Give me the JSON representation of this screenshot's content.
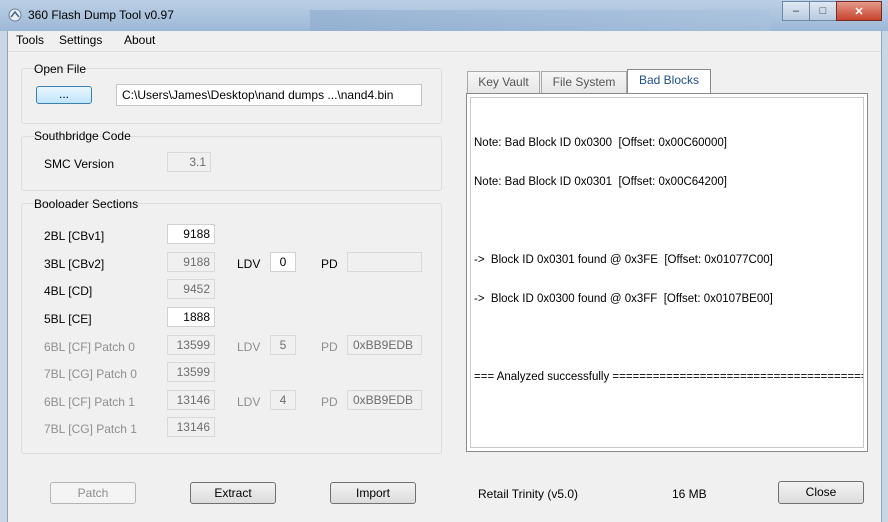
{
  "window": {
    "title": "360 Flash Dump Tool  v0.97",
    "buttons": {
      "minimize": "–",
      "maximize": "□",
      "close": "✕"
    }
  },
  "menu": {
    "items": [
      "Tools",
      "Settings",
      "About"
    ]
  },
  "open_file": {
    "title": "Open File",
    "button_label": "...",
    "path": "C:\\Users\\James\\Desktop\\nand dumps ...\\nand4.bin"
  },
  "southbridge": {
    "title": "Southbridge Code",
    "smc_label": "SMC Version",
    "smc_value": "3.1"
  },
  "bootloader": {
    "title": "Booloader Sections",
    "rows": [
      {
        "label": "2BL [CBv1]",
        "value": "9188"
      },
      {
        "label": "3BL [CBv2]",
        "value": "9188",
        "ldv_label": "LDV",
        "ldv": "0",
        "pd_label": "PD",
        "pd": ""
      },
      {
        "label": "4BL [CD]",
        "value": "9452"
      },
      {
        "label": "5BL [CE]",
        "value": "1888"
      },
      {
        "label": "6BL [CF] Patch 0",
        "value": "13599",
        "ldv_label": "LDV",
        "ldv": "5",
        "pd_label": "PD",
        "pd": "0xBB9EDB"
      },
      {
        "label": "7BL [CG] Patch 0",
        "value": "13599"
      },
      {
        "label": "6BL [CF] Patch 1",
        "value": "13146",
        "ldv_label": "LDV",
        "ldv": "4",
        "pd_label": "PD",
        "pd": "0xBB9EDB"
      },
      {
        "label": "7BL [CG] Patch 1",
        "value": "13146"
      }
    ]
  },
  "tabs": {
    "items": [
      "Key Vault",
      "File System",
      "Bad Blocks"
    ],
    "active": "Bad Blocks"
  },
  "log": {
    "lines": [
      "Note: Bad Block ID 0x0300  [Offset: 0x00C60000]",
      "Note: Bad Block ID 0x0301  [Offset: 0x00C64200]",
      "",
      "->  Block ID 0x0301 found @ 0x3FE  [Offset: 0x01077C00]",
      "->  Block ID 0x0300 found @ 0x3FF  [Offset: 0x0107BE00]",
      "",
      "=== Analyzed successfully ========================================"
    ]
  },
  "bottom": {
    "patch_label": "Patch",
    "extract_label": "Extract",
    "import_label": "Import",
    "console_type": "Retail Trinity (v5.0)",
    "size": "16 MB",
    "close_label": "Close"
  }
}
